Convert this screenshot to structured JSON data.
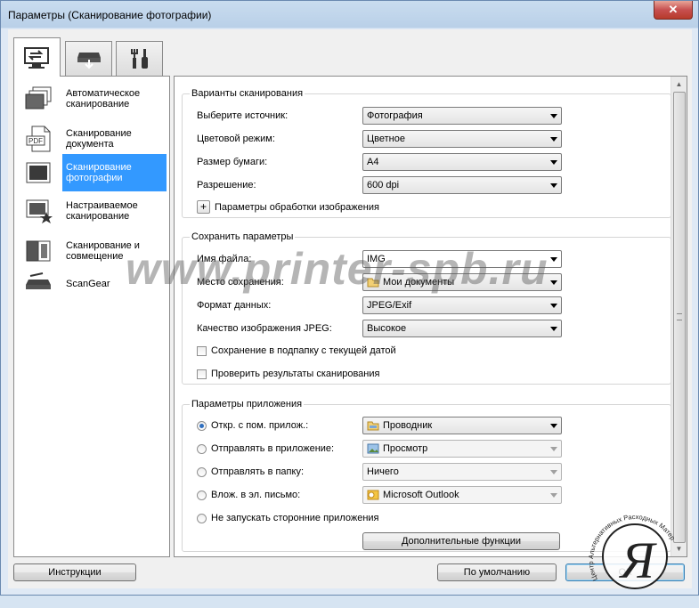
{
  "window": {
    "title": "Параметры (Сканирование фотографии)",
    "close_label": "✕"
  },
  "tabs": [
    {
      "name": "scan-from-computer",
      "icon": "computer-scan-icon"
    },
    {
      "name": "scan-from-panel",
      "icon": "scanner-icon"
    },
    {
      "name": "general-settings",
      "icon": "tools-icon"
    }
  ],
  "modes": [
    {
      "label": "Автоматическое сканирование",
      "icon": "auto-scan-icon"
    },
    {
      "label": "Сканирование документа",
      "icon": "pdf-document-icon"
    },
    {
      "label": "Сканирование фотографии",
      "icon": "photo-icon",
      "selected": true
    },
    {
      "label": "Настраиваемое сканирование",
      "icon": "custom-scan-icon"
    },
    {
      "label": "Сканирование и совмещение",
      "icon": "stitch-icon"
    },
    {
      "label": "ScanGear",
      "icon": "scangear-icon"
    }
  ],
  "scan_options": {
    "title": "Варианты сканирования",
    "source_label": "Выберите источник:",
    "source_value": "Фотография",
    "color_label": "Цветовой режим:",
    "color_value": "Цветное",
    "paper_label": "Размер бумаги:",
    "paper_value": "А4",
    "resolution_label": "Разрешение:",
    "resolution_value": "600 dpi",
    "image_processing_label": "Параметры обработки изображения"
  },
  "save_settings": {
    "title": "Сохранить параметры",
    "filename_label": "Имя файла:",
    "filename_value": "IMG",
    "location_label": "Место сохранения:",
    "location_value": "Мои документы",
    "format_label": "Формат данных:",
    "format_value": "JPEG/Exif",
    "quality_label": "Качество изображения JPEG:",
    "quality_value": "Высокое",
    "subfolder_label": "Сохранение в подпапку с текущей датой",
    "check_results_label": "Проверить результаты сканирования"
  },
  "app_settings": {
    "title": "Параметры приложения",
    "open_label": "Откр. с пом. прилож.:",
    "open_value": "Проводник",
    "send_app_label": "Отправлять в приложение:",
    "send_app_value": "Просмотр",
    "send_folder_label": "Отправлять в папку:",
    "send_folder_value": "Ничего",
    "email_label": "Влож. в эл. письмо:",
    "email_value": "Microsoft Outlook",
    "no_app_label": "Не запускать сторонние приложения",
    "more_functions_label": "Дополнительные функции"
  },
  "footer": {
    "instructions_label": "Инструкции",
    "defaults_label": "По умолчанию",
    "ok_label": "ОК"
  },
  "watermark": {
    "text": "www.printer-spb.ru"
  },
  "stamp": {
    "text": "Центр Альтернативных Расходных Материалов"
  }
}
